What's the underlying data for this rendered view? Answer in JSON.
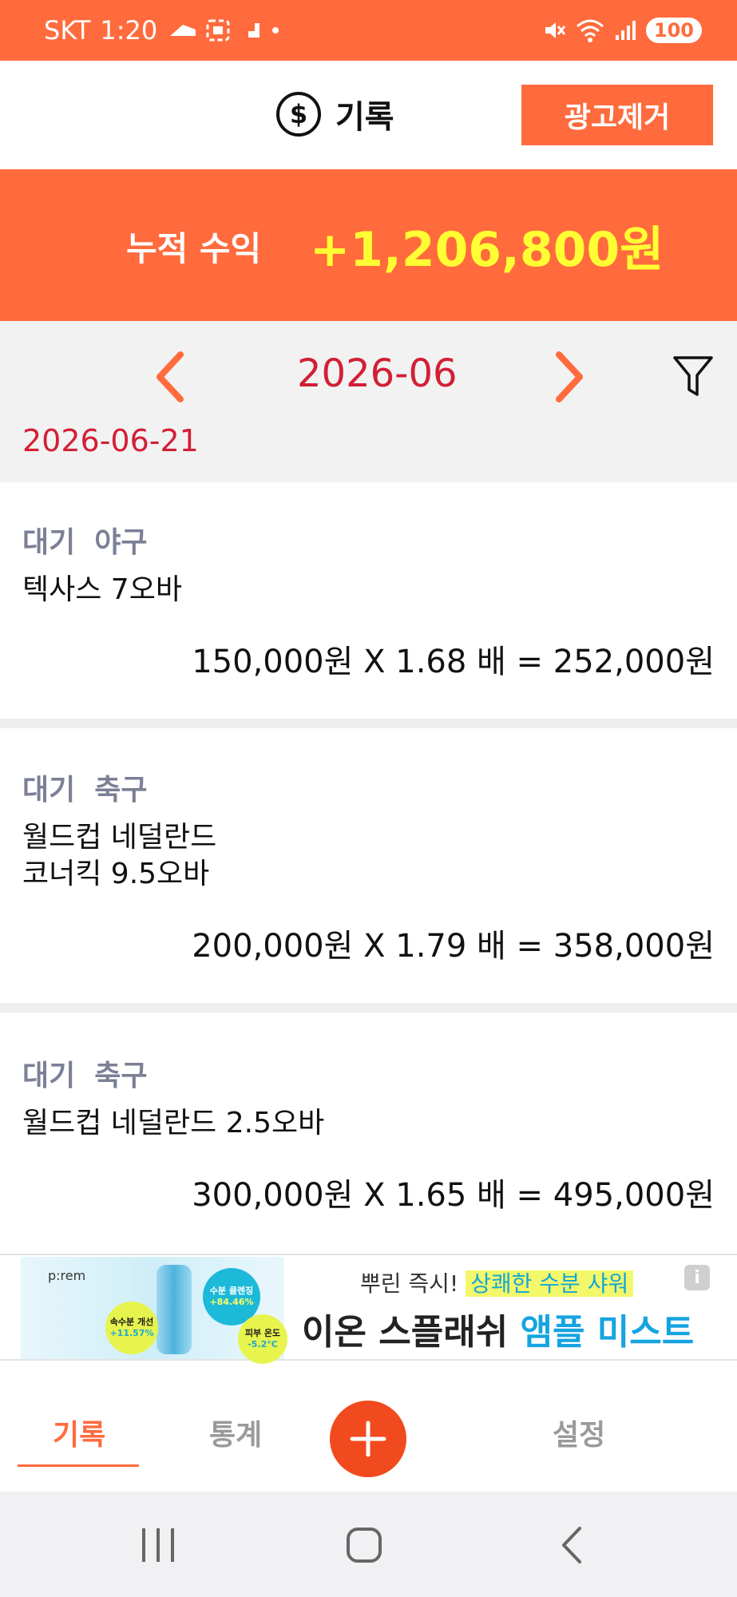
{
  "status_bar": {
    "carrier": "SKT",
    "time": "1:20",
    "battery": "100"
  },
  "header": {
    "title": "기록",
    "ad_remove_label": "광고제거"
  },
  "summary": {
    "label": "누적 수익",
    "value": "+1,206,800원"
  },
  "month_nav": {
    "month": "2026-06"
  },
  "date_group": {
    "date": "2026-06-21"
  },
  "entries": [
    {
      "status": "대기",
      "sport": "야구",
      "desc_lines": [
        "텍사스 7오바"
      ],
      "calc": "150,000원 X 1.68 배 = 252,000원"
    },
    {
      "status": "대기",
      "sport": "축구",
      "desc_lines": [
        "월드컵 네덜란드",
        "코너킥 9.5오바"
      ],
      "calc": "200,000원 X 1.79 배 = 358,000원"
    },
    {
      "status": "대기",
      "sport": "축구",
      "desc_lines": [
        "월드컵 네덜란드  2.5오바"
      ],
      "calc": "300,000원 X 1.65 배 = 495,000원"
    }
  ],
  "ad": {
    "brand": "p:rem",
    "bubble1_label": "속수분 개선",
    "bubble1_value": "+11.57%",
    "bubble2_label": "수분 클렌징",
    "bubble2_value": "+84.46%",
    "bubble3_label": "피부 온도",
    "bubble3_value": "-5.2°C",
    "line1_prefix": "뿌린 즉시!",
    "line1_highlight": "상쾌한 수분 샤워",
    "line2_part1": "이온 스플래쉬",
    "line2_part2": "앰플 미스트",
    "info_icon": "i"
  },
  "tabs": {
    "records": "기록",
    "stats": "통계",
    "settings": "설정"
  },
  "colors": {
    "accent": "#ff6b3d",
    "profit": "#ffff33",
    "date_red": "#d21f35",
    "fab": "#f24a1f"
  }
}
